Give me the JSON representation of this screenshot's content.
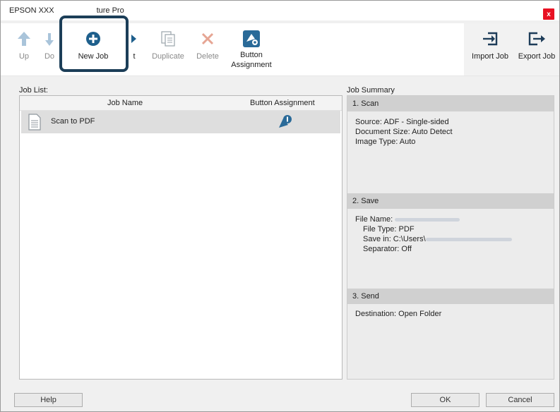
{
  "window": {
    "title_left": "EPSON XXX",
    "title_right": "ture Pro",
    "close_label": "x"
  },
  "toolbar": {
    "up": "Up",
    "do_partial": "Do",
    "new_job": "New Job",
    "edit_partial": "t",
    "duplicate": "Duplicate",
    "delete": "Delete",
    "button_assignment_l1": "Button",
    "button_assignment_l2": "Assignment",
    "import_job": "Import Job",
    "export_job": "Export Job"
  },
  "job_list": {
    "label": "Job List:",
    "columns": [
      "Job Name",
      "Button Assignment"
    ],
    "rows": [
      {
        "name": "Scan to PDF"
      }
    ]
  },
  "summary": {
    "label": "Job Summary",
    "scan": {
      "header": "1. Scan",
      "source": "Source: ADF - Single-sided",
      "document_size": "Document Size: Auto Detect",
      "image_type": "Image Type: Auto"
    },
    "save": {
      "header": "2. Save",
      "file_name": "File Name:",
      "file_type": "File Type: PDF",
      "save_in": "Save in: C:\\Users\\",
      "separator": "Separator: Off"
    },
    "send": {
      "header": "3. Send",
      "destination": "Destination: Open Folder"
    }
  },
  "buttons": {
    "help": "Help",
    "ok": "OK",
    "cancel": "Cancel"
  },
  "colors": {
    "accent": "#1e5f8c",
    "highlight_frame": "#1c3e58",
    "delete_x": "#e6a593",
    "close": "#e81123"
  }
}
